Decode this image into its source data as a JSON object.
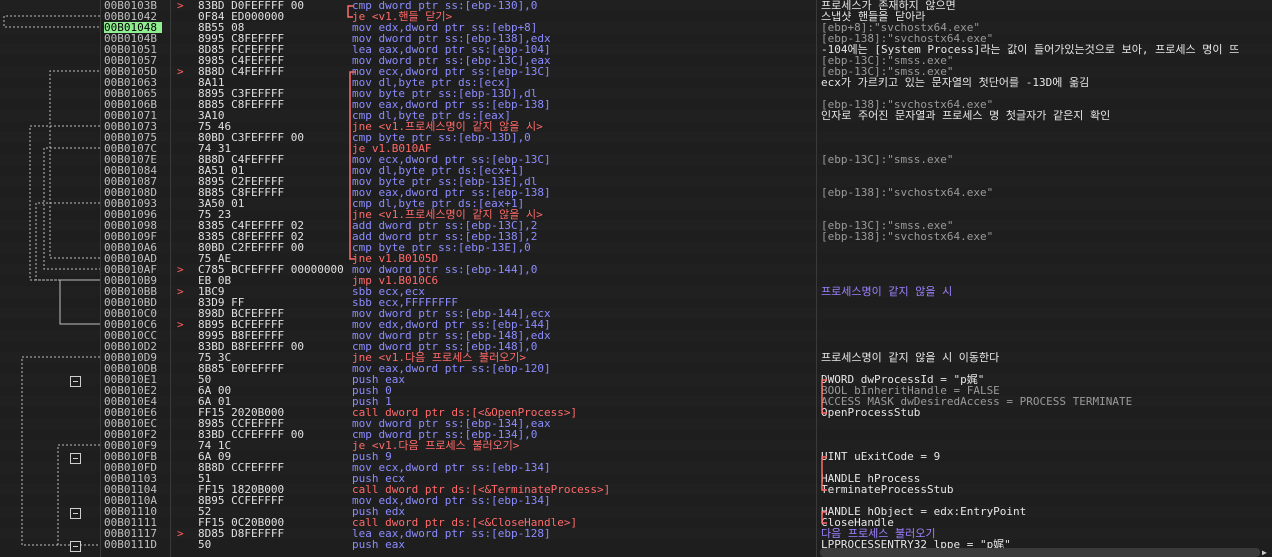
{
  "rows": [
    {
      "addr": "00B0103B",
      "mark": ">",
      "bytes": "83BD D0FEFFFF 00",
      "instr": "cmp dword ptr ss:[ebp-130],0",
      "kind": "",
      "comment": "프로세스가 존재하지 않으면",
      "ctype": ""
    },
    {
      "addr": "00B01042",
      "mark": "",
      "bytes": "0F84 ED000000",
      "instr": "je <v1.핸들 닫기>",
      "kind": "jmp",
      "comment": "스냅샷 핸들을 닫아라",
      "ctype": ""
    },
    {
      "addr": "00B01048",
      "mark": "",
      "bytes": "8B55 08",
      "instr": "mov edx,dword ptr ss:[ebp+8]",
      "kind": "",
      "comment": "[ebp+8]:\"svchostx64.exe\"",
      "ctype": "gray",
      "eip": true
    },
    {
      "addr": "00B0104B",
      "mark": "",
      "bytes": "8995 C8FEFFFF",
      "instr": "mov dword ptr ss:[ebp-138],edx",
      "kind": "",
      "comment": "[ebp-138]:\"svchostx64.exe\"",
      "ctype": "gray"
    },
    {
      "addr": "00B01051",
      "mark": "",
      "bytes": "8D85 FCFEFFFF",
      "instr": "lea eax,dword ptr ss:[ebp-104]",
      "kind": "",
      "comment": "-104에는 [System Process]라는 값이 들어가있는것으로 보아, 프로세스 명이 뜨",
      "ctype": ""
    },
    {
      "addr": "00B01057",
      "mark": "",
      "bytes": "8985 C4FEFFFF",
      "instr": "mov dword ptr ss:[ebp-13C],eax",
      "kind": "",
      "comment": "[ebp-13C]:\"smss.exe\"",
      "ctype": "gray"
    },
    {
      "addr": "00B0105D",
      "mark": ">",
      "bytes": "8B8D C4FEFFFF",
      "instr": "mov ecx,dword ptr ss:[ebp-13C]",
      "kind": "",
      "comment": "[ebp-13C]:\"smss.exe\"",
      "ctype": "gray"
    },
    {
      "addr": "00B01063",
      "mark": "",
      "bytes": "8A11",
      "instr": "mov dl,byte ptr ds:[ecx]",
      "kind": "",
      "comment": "ecx가 가르키고 있는 문자열의 첫단어를 -13D에 옮김",
      "ctype": ""
    },
    {
      "addr": "00B01065",
      "mark": "",
      "bytes": "8895 C3FEFFFF",
      "instr": "mov byte ptr ss:[ebp-13D],dl",
      "kind": "",
      "comment": "",
      "ctype": ""
    },
    {
      "addr": "00B0106B",
      "mark": "",
      "bytes": "8B85 C8FEFFFF",
      "instr": "mov eax,dword ptr ss:[ebp-138]",
      "kind": "",
      "comment": "[ebp-138]:\"svchostx64.exe\"",
      "ctype": "gray"
    },
    {
      "addr": "00B01071",
      "mark": "",
      "bytes": "3A10",
      "instr": "cmp dl,byte ptr ds:[eax]",
      "kind": "",
      "comment": "인자로 주어진 문자열과 프로세스 명 첫글자가 같은지 확인",
      "ctype": ""
    },
    {
      "addr": "00B01073",
      "mark": "",
      "bytes": "75 46",
      "instr": "jne <v1.프로세스명이 같지 않을 시>",
      "kind": "jmp",
      "comment": "",
      "ctype": ""
    },
    {
      "addr": "00B01075",
      "mark": "",
      "bytes": "80BD C3FEFFFF 00",
      "instr": "cmp byte ptr ss:[ebp-13D],0",
      "kind": "",
      "comment": "",
      "ctype": ""
    },
    {
      "addr": "00B0107C",
      "mark": "",
      "bytes": "74 31",
      "instr": "je v1.B010AF",
      "kind": "jmp",
      "comment": "",
      "ctype": ""
    },
    {
      "addr": "00B0107E",
      "mark": "",
      "bytes": "8B8D C4FEFFFF",
      "instr": "mov ecx,dword ptr ss:[ebp-13C]",
      "kind": "",
      "comment": "[ebp-13C]:\"smss.exe\"",
      "ctype": "gray"
    },
    {
      "addr": "00B01084",
      "mark": "",
      "bytes": "8A51 01",
      "instr": "mov dl,byte ptr ds:[ecx+1]",
      "kind": "",
      "comment": "",
      "ctype": ""
    },
    {
      "addr": "00B01087",
      "mark": "",
      "bytes": "8895 C2FEFFFF",
      "instr": "mov byte ptr ss:[ebp-13E],dl",
      "kind": "",
      "comment": "",
      "ctype": ""
    },
    {
      "addr": "00B0108D",
      "mark": "",
      "bytes": "8B85 C8FEFFFF",
      "instr": "mov eax,dword ptr ss:[ebp-138]",
      "kind": "",
      "comment": "[ebp-138]:\"svchostx64.exe\"",
      "ctype": "gray"
    },
    {
      "addr": "00B01093",
      "mark": "",
      "bytes": "3A50 01",
      "instr": "cmp dl,byte ptr ds:[eax+1]",
      "kind": "",
      "comment": "",
      "ctype": ""
    },
    {
      "addr": "00B01096",
      "mark": "",
      "bytes": "75 23",
      "instr": "jne <v1.프로세스명이 같지 않을 시>",
      "kind": "jmp",
      "comment": "",
      "ctype": ""
    },
    {
      "addr": "00B01098",
      "mark": "",
      "bytes": "8385 C4FEFFFF 02",
      "instr": "add dword ptr ss:[ebp-13C],2",
      "kind": "",
      "comment": "[ebp-13C]:\"smss.exe\"",
      "ctype": "gray"
    },
    {
      "addr": "00B0109F",
      "mark": "",
      "bytes": "8385 C8FEFFFF 02",
      "instr": "add dword ptr ss:[ebp-138],2",
      "kind": "",
      "comment": "[ebp-138]:\"svchostx64.exe\"",
      "ctype": "gray"
    },
    {
      "addr": "00B010A6",
      "mark": "",
      "bytes": "80BD C2FEFFFF 00",
      "instr": "cmp byte ptr ss:[ebp-13E],0",
      "kind": "",
      "comment": "",
      "ctype": ""
    },
    {
      "addr": "00B010AD",
      "mark": "",
      "bytes": "75 AE",
      "instr": "jne v1.B0105D",
      "kind": "jmp",
      "comment": "",
      "ctype": ""
    },
    {
      "addr": "00B010AF",
      "mark": ">",
      "bytes": "C785 BCFEFFFF 00000000",
      "instr": "mov dword ptr ss:[ebp-144],0",
      "kind": "",
      "comment": "",
      "ctype": ""
    },
    {
      "addr": "00B010B9",
      "mark": "",
      "bytes": "EB 0B",
      "instr": "jmp v1.B010C6",
      "kind": "jmp",
      "comment": "",
      "ctype": ""
    },
    {
      "addr": "00B010BB",
      "mark": ">",
      "bytes": "1BC9",
      "instr": "sbb ecx,ecx",
      "kind": "",
      "comment": "프로세스명이 같지 않을 시",
      "ctype": "purple"
    },
    {
      "addr": "00B010BD",
      "mark": "",
      "bytes": "83D9 FF",
      "instr": "sbb ecx,FFFFFFFF",
      "kind": "",
      "comment": "",
      "ctype": ""
    },
    {
      "addr": "00B010C0",
      "mark": "",
      "bytes": "898D BCFEFFFF",
      "instr": "mov dword ptr ss:[ebp-144],ecx",
      "kind": "",
      "comment": "",
      "ctype": ""
    },
    {
      "addr": "00B010C6",
      "mark": ">",
      "bytes": "8B95 BCFEFFFF",
      "instr": "mov edx,dword ptr ss:[ebp-144]",
      "kind": "",
      "comment": "",
      "ctype": ""
    },
    {
      "addr": "00B010CC",
      "mark": "",
      "bytes": "8995 B8FEFFFF",
      "instr": "mov dword ptr ss:[ebp-148],edx",
      "kind": "",
      "comment": "",
      "ctype": ""
    },
    {
      "addr": "00B010D2",
      "mark": "",
      "bytes": "83BD B8FEFFFF 00",
      "instr": "cmp dword ptr ss:[ebp-148],0",
      "kind": "",
      "comment": "",
      "ctype": ""
    },
    {
      "addr": "00B010D9",
      "mark": "",
      "bytes": "75 3C",
      "instr": "jne <v1.다음 프로세스 불러오기>",
      "kind": "jmp",
      "comment": "프로세스명이 같지 않을 시 이동한다",
      "ctype": ""
    },
    {
      "addr": "00B010DB",
      "mark": "",
      "bytes": "8B85 E0FEFFFF",
      "instr": "mov eax,dword ptr ss:[ebp-120]",
      "kind": "",
      "comment": "",
      "ctype": ""
    },
    {
      "addr": "00B010E1",
      "mark": "",
      "bytes": "50",
      "instr": "push eax",
      "kind": "push",
      "comment": "DWORD dwProcessId = \"p娓\"",
      "ctype": "",
      "bracket": "start"
    },
    {
      "addr": "00B010E2",
      "mark": "",
      "bytes": "6A 00",
      "instr": "push 0",
      "kind": "push",
      "comment": "BOOL bInheritHandle = FALSE",
      "ctype": "gray",
      "bracket": "mid"
    },
    {
      "addr": "00B010E4",
      "mark": "",
      "bytes": "6A 01",
      "instr": "push 1",
      "kind": "push",
      "comment": "ACCESS_MASK dwDesiredAccess = PROCESS_TERMINATE",
      "ctype": "gray",
      "bracket": "mid"
    },
    {
      "addr": "00B010E6",
      "mark": "",
      "bytes": "FF15 2020B000",
      "instr": "call dword ptr ds:[<&OpenProcess>]",
      "kind": "call",
      "comment": "OpenProcessStub",
      "ctype": "",
      "bracket": "end"
    },
    {
      "addr": "00B010EC",
      "mark": "",
      "bytes": "8985 CCFEFFFF",
      "instr": "mov dword ptr ss:[ebp-134],eax",
      "kind": "",
      "comment": "",
      "ctype": ""
    },
    {
      "addr": "00B010F2",
      "mark": "",
      "bytes": "83BD CCFEFFFF 00",
      "instr": "cmp dword ptr ss:[ebp-134],0",
      "kind": "",
      "comment": "",
      "ctype": ""
    },
    {
      "addr": "00B010F9",
      "mark": "",
      "bytes": "74 1C",
      "instr": "je <v1.다음 프로세스 불러오기>",
      "kind": "jmp",
      "comment": "",
      "ctype": ""
    },
    {
      "addr": "00B010FB",
      "mark": "",
      "bytes": "6A 09",
      "instr": "push 9",
      "kind": "push",
      "comment": "UINT uExitCode = 9",
      "ctype": "",
      "bracket": "start"
    },
    {
      "addr": "00B010FD",
      "mark": "",
      "bytes": "8B8D CCFEFFFF",
      "instr": "mov ecx,dword ptr ss:[ebp-134]",
      "kind": "",
      "comment": "",
      "ctype": "",
      "bracket": "mid"
    },
    {
      "addr": "00B01103",
      "mark": "",
      "bytes": "51",
      "instr": "push ecx",
      "kind": "push",
      "comment": "HANDLE hProcess",
      "ctype": "",
      "bracket": "mid"
    },
    {
      "addr": "00B01104",
      "mark": "",
      "bytes": "FF15 1820B000",
      "instr": "call dword ptr ds:[<&TerminateProcess>]",
      "kind": "call",
      "comment": "TerminateProcessStub",
      "ctype": "",
      "bracket": "end"
    },
    {
      "addr": "00B0110A",
      "mark": "",
      "bytes": "8B95 CCFEFFFF",
      "instr": "mov edx,dword ptr ss:[ebp-134]",
      "kind": "",
      "comment": "",
      "ctype": ""
    },
    {
      "addr": "00B01110",
      "mark": "",
      "bytes": "52",
      "instr": "push edx",
      "kind": "push",
      "comment": "HANDLE hObject = edx:EntryPoint",
      "ctype": "",
      "bracket": "start"
    },
    {
      "addr": "00B01111",
      "mark": "",
      "bytes": "FF15 0C20B000",
      "instr": "call dword ptr ds:[<&CloseHandle>]",
      "kind": "call",
      "comment": "CloseHandle",
      "ctype": "",
      "bracket": "end"
    },
    {
      "addr": "00B01117",
      "mark": ">",
      "bytes": "8D85 D8FEFFFF",
      "instr": "lea eax,dword ptr ss:[ebp-128]",
      "kind": "",
      "comment": "다음 프로세스 불러오기",
      "ctype": "purple"
    },
    {
      "addr": "00B0111D",
      "mark": "",
      "bytes": "50",
      "instr": "push eax",
      "kind": "push",
      "comment": "LPPROCESSENTRY32 lppe = \"p娓\"",
      "ctype": "",
      "bracket": "start"
    }
  ],
  "colors": {
    "background": "#1e1e1e",
    "eip_highlight": "#90ee90",
    "jump": "#ff6a6a",
    "instruction": "#8c8cff"
  }
}
